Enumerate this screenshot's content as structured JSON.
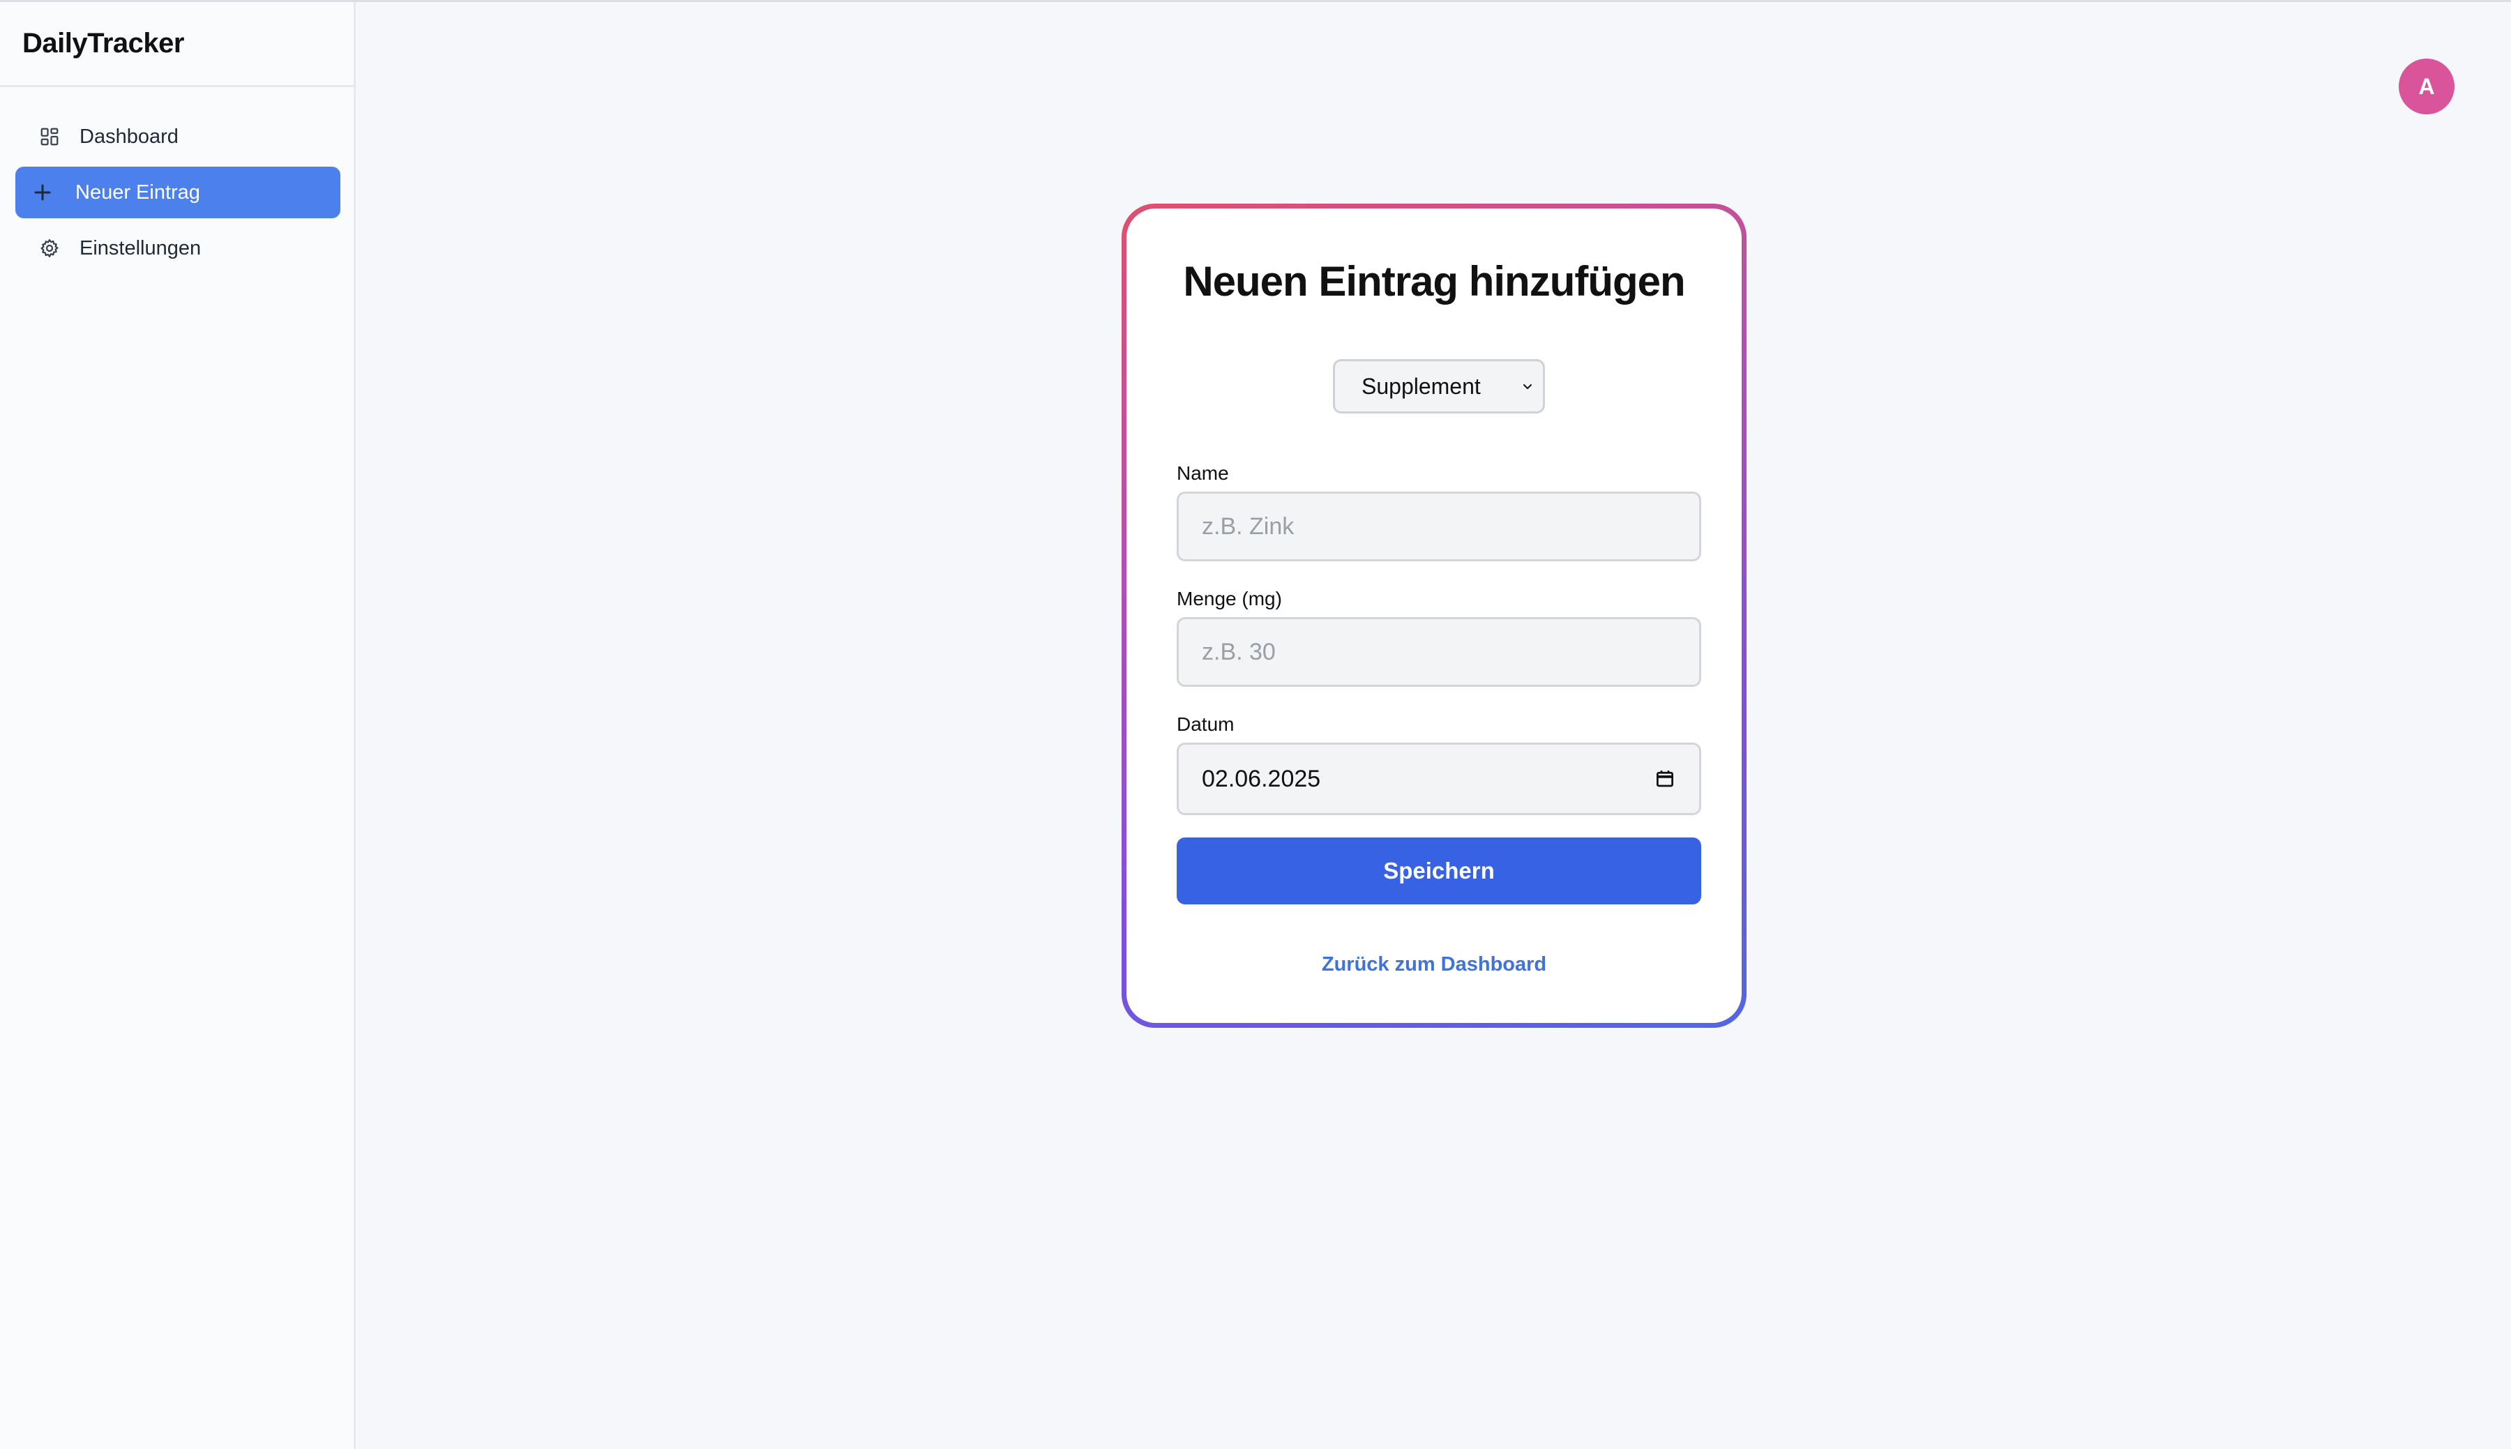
{
  "app": {
    "brand": "DailyTracker"
  },
  "sidebar": {
    "items": [
      {
        "label": "Dashboard",
        "icon": "dashboard-grid-icon",
        "active": false
      },
      {
        "label": "Neuer Eintrag",
        "icon": "plus-icon",
        "active": true
      },
      {
        "label": "Einstellungen",
        "icon": "gear-icon",
        "active": false
      }
    ]
  },
  "header": {
    "avatar_initial": "A",
    "avatar_color": "#d9549a"
  },
  "form": {
    "title": "Neuen Eintrag hinzufügen",
    "type_select": {
      "selected": "Supplement"
    },
    "name": {
      "label": "Name",
      "placeholder": "z.B. Zink",
      "value": ""
    },
    "amount": {
      "label": "Menge (mg)",
      "placeholder": "z.B. 30",
      "value": ""
    },
    "date": {
      "label": "Datum",
      "value": "02.06.2025"
    },
    "save_label": "Speichern",
    "back_link": "Zurück zum Dashboard"
  },
  "colors": {
    "accent": "#3762e3",
    "nav_active": "#4c80ed",
    "link": "#3f73dc",
    "card_gradient": [
      "#e0506f",
      "#b34fb3",
      "#7d4fe0",
      "#5168e0"
    ]
  }
}
